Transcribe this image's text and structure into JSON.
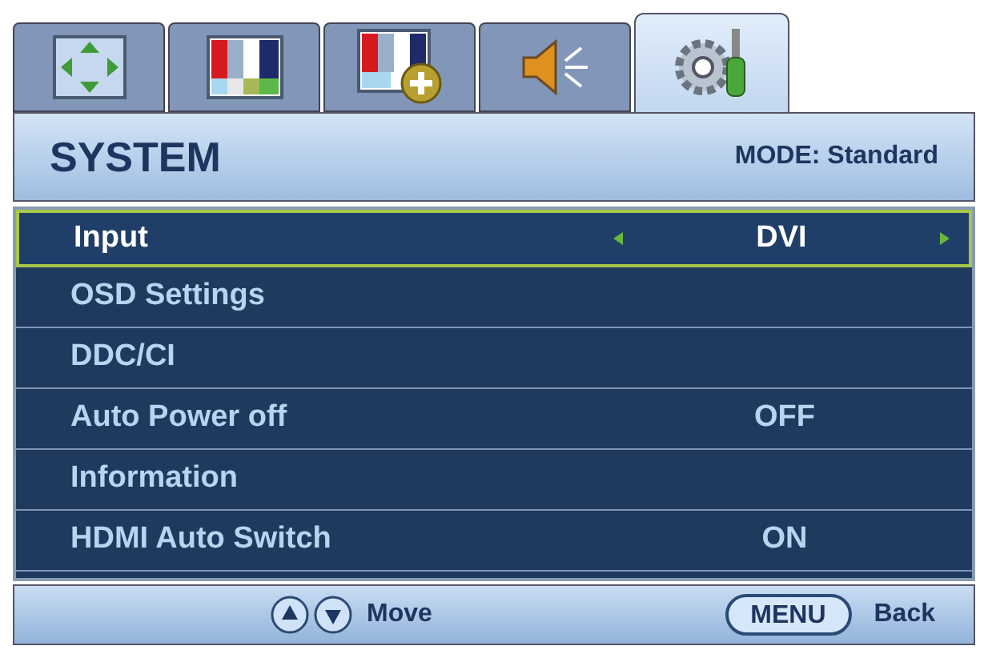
{
  "tabs": [
    {
      "kind": "picture-adjust",
      "selected": false
    },
    {
      "kind": "picture",
      "selected": false
    },
    {
      "kind": "picture-advanced",
      "selected": false
    },
    {
      "kind": "audio",
      "selected": false
    },
    {
      "kind": "system",
      "selected": true
    }
  ],
  "header": {
    "title": "SYSTEM",
    "mode": "MODE: Standard"
  },
  "menu": [
    {
      "label": "Input",
      "value": "DVI",
      "selected": true
    },
    {
      "label": "OSD Settings",
      "selected": false
    },
    {
      "label": "DDC/CI",
      "selected": false
    },
    {
      "label": "Auto Power off",
      "value": "OFF",
      "selected": false
    },
    {
      "label": "Information",
      "selected": false
    },
    {
      "label": "HDMI Auto Switch",
      "value": "ON",
      "selected": false
    }
  ],
  "footer": {
    "move": "Move",
    "menu_key": "MENU",
    "back": "Back"
  }
}
